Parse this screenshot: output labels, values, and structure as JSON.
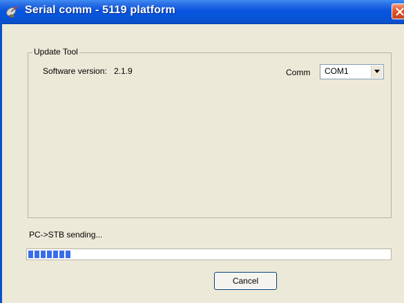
{
  "window": {
    "title": "Serial comm - 5119 platform",
    "icon": "satellite-dish-icon",
    "close_icon": "close-icon",
    "titlebar_color": "#0a54e0"
  },
  "groupbox": {
    "legend": "Update Tool",
    "software_version_label": "Software version:",
    "software_version_value": "2.1.9",
    "comm_label": "Comm",
    "comm_selected": "COM1",
    "comm_dropdown_icon": "chevron-down-icon"
  },
  "status": {
    "text": "PC->STB sending...",
    "progress_fraction": 0.12,
    "progress_color": "#3a6ee8"
  },
  "buttons": {
    "cancel_label": "Cancel"
  }
}
